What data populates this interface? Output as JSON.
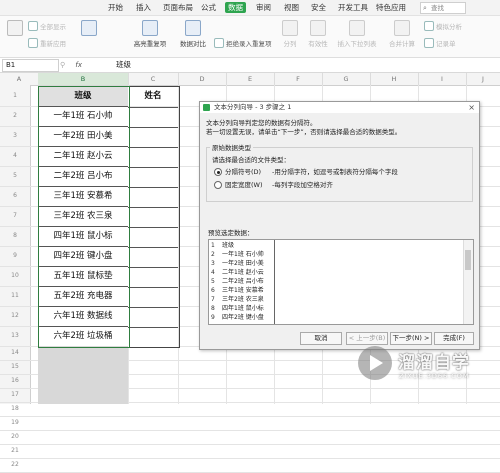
{
  "menu": {
    "items": [
      "开始",
      "插入",
      "页面布局",
      "公式",
      "数据",
      "审阅",
      "视图",
      "安全",
      "开发工具",
      "特色应用"
    ],
    "active": "数据",
    "search_placeholder": "查找"
  },
  "ribbon": {
    "filter_show_all": "全部显示",
    "filter_reapply": "重新应用",
    "highlight_duplicates": "高亮重复项",
    "data_compare": "数据对比",
    "reject_duplicates": "拒绝录入重复项",
    "split": "分列",
    "valid": "有效性",
    "insert_dropdown": "插入下拉列表",
    "merge_calc": "合并计算",
    "simulate": "模拟分析",
    "record": "记录单"
  },
  "formula_bar": {
    "cell_ref": "B1",
    "fx": "fx",
    "value": "班级"
  },
  "columns": [
    "A",
    "B",
    "C",
    "D",
    "E",
    "F",
    "G",
    "H",
    "I",
    "J"
  ],
  "rows": [
    "1",
    "2",
    "3",
    "4",
    "5",
    "6",
    "7",
    "8",
    "9",
    "10",
    "11",
    "12",
    "13",
    "14",
    "15",
    "16",
    "17",
    "18",
    "19",
    "20",
    "21",
    "22"
  ],
  "table": {
    "header_class": "班级",
    "header_name": "姓名",
    "classes": [
      "一年1班 石小帅",
      "一年2班 田小美",
      "二年1班 赵小云",
      "二年2班 吕小布",
      "三年1班 安慕希",
      "三年2班 农三泉",
      "四年1班 鼠小标",
      "四年2班 键小盘",
      "五年1班 鼠标垫",
      "五年2班 充电器",
      "六年1班 数据线",
      "六年2班 垃圾桶"
    ]
  },
  "dialog": {
    "title": "文本分列向导 - 3 步骤之 1",
    "intro_line1": "文本分列向导判定您的数据有分隔符。",
    "intro_line2": "若一切设置无误，请单击“下一步”，否则请选择最合适的数据类型。",
    "group_title": "原始数据类型",
    "choose_label": "请选择最合适的文件类型：",
    "option_delimited": "分隔符号(D)",
    "option_delimited_desc": "-用分隔字符，如逗号或制表符分隔每个字段",
    "option_fixed": "固定宽度(W)",
    "option_fixed_desc": "-每列字段加空格对齐",
    "preview_label": "预览选定数据：",
    "preview_rows": [
      {
        "n": "1",
        "t": "班级"
      },
      {
        "n": "2",
        "t": "一年1班 石小帅"
      },
      {
        "n": "3",
        "t": "一年2班 田小美"
      },
      {
        "n": "4",
        "t": "二年1班 赵小云"
      },
      {
        "n": "5",
        "t": "二年2班 吕小布"
      },
      {
        "n": "6",
        "t": "三年1班 安慕希"
      },
      {
        "n": "7",
        "t": "三年2班 农三泉"
      },
      {
        "n": "8",
        "t": "四年1班 鼠小标"
      },
      {
        "n": "9",
        "t": "四年2班 键小盘"
      }
    ],
    "btn_cancel": "取消",
    "btn_prev": "< 上一步(B)",
    "btn_next": "下一步(N) >",
    "btn_finish": "完成(F)"
  },
  "watermark": {
    "name": "溜溜自学",
    "url": "ZIXUE.3D66.COM"
  }
}
